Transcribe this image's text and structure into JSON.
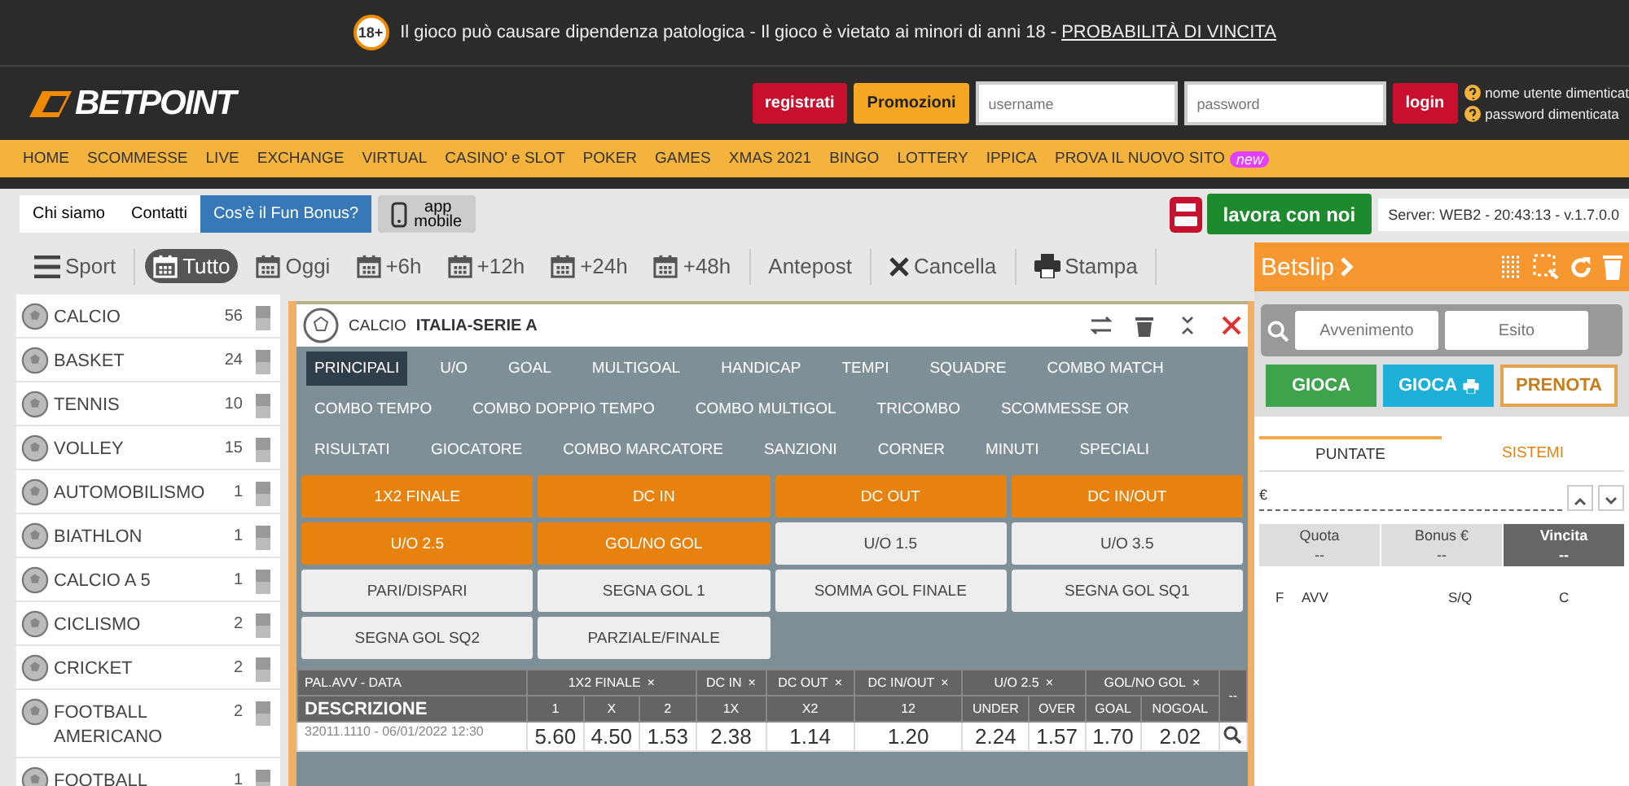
{
  "notice": {
    "badge": "18+",
    "text": "Il gioco può causare dipendenza patologica - Il gioco è vietato ai minori di anni 18 - ",
    "link": "PROBABILITÀ DI VINCITA"
  },
  "header": {
    "logo": "BETPOINT",
    "register": "registrati",
    "promo": "Promozioni",
    "username": {
      "placeholder": "username"
    },
    "password": {
      "placeholder": "password"
    },
    "login": "login",
    "help": [
      "nome utente dimenticat",
      "password dimenticata"
    ]
  },
  "nav": {
    "items": [
      "HOME",
      "SCOMMESSE",
      "LIVE",
      "EXCHANGE",
      "VIRTUAL",
      "CASINO' e SLOT",
      "POKER",
      "GAMES",
      "XMAS 2021",
      "BINGO",
      "LOTTERY",
      "IPPICA",
      "PROVA IL NUOVO SITO"
    ],
    "badge": "new"
  },
  "top_links": [
    {
      "label": "Chi siamo",
      "kind": "plain"
    },
    {
      "label": "Contatti",
      "kind": "plain"
    },
    {
      "label": "Cos'è il Fun Bonus?",
      "kind": "blue"
    },
    {
      "label": "app\nmobile",
      "kind": "app"
    }
  ],
  "jobs": "lavora con noi",
  "server": "Server: WEB2 - 20:43:13 - v.1.7.0.0",
  "filters": [
    {
      "label": "Sport",
      "kind": "menu",
      "selected": false
    },
    {
      "label": "Tutto",
      "kind": "date",
      "selected": true
    },
    {
      "label": "Oggi",
      "kind": "date",
      "selected": false
    },
    {
      "label": "+6h",
      "kind": "date",
      "selected": false
    },
    {
      "label": "+12h",
      "kind": "date",
      "selected": false
    },
    {
      "label": "+24h",
      "kind": "date",
      "selected": false
    },
    {
      "label": "+48h",
      "kind": "date",
      "selected": false
    },
    {
      "label": "Antepost",
      "kind": "plain",
      "selected": false
    },
    {
      "label": "Cancella",
      "kind": "clear",
      "selected": false
    },
    {
      "label": "Stampa",
      "kind": "print",
      "selected": false
    }
  ],
  "sports": [
    {
      "name": "CALCIO",
      "count": "56"
    },
    {
      "name": "BASKET",
      "count": "24"
    },
    {
      "name": "TENNIS",
      "count": "10"
    },
    {
      "name": "VOLLEY",
      "count": "15"
    },
    {
      "name": "AUTOMOBILISMO",
      "count": "1"
    },
    {
      "name": "BIATHLON",
      "count": "1"
    },
    {
      "name": "CALCIO A 5",
      "count": "1"
    },
    {
      "name": "CICLISMO",
      "count": "2"
    },
    {
      "name": "CRICKET",
      "count": "2"
    },
    {
      "name": "FOOTBALL AMERICANO",
      "count": "2"
    },
    {
      "name": "FOOTBALL",
      "count": "1"
    }
  ],
  "event": {
    "sport": "CALCIO",
    "league": "ITALIA-SERIE A",
    "market_tabs": [
      {
        "label": "PRINCIPALI",
        "selected": true
      },
      {
        "label": "U/O",
        "selected": false
      },
      {
        "label": "GOAL",
        "selected": false
      },
      {
        "label": "MULTIGOAL",
        "selected": false
      },
      {
        "label": "HANDICAP",
        "selected": false
      },
      {
        "label": "TEMPI",
        "selected": false
      },
      {
        "label": "SQUADRE",
        "selected": false
      },
      {
        "label": "COMBO MATCH",
        "selected": false
      },
      {
        "label": "COMBO TEMPO",
        "selected": false
      },
      {
        "label": "COMBO DOPPIO TEMPO",
        "selected": false
      },
      {
        "label": "COMBO MULTIGOL",
        "selected": false
      },
      {
        "label": "TRICOMBO",
        "selected": false
      },
      {
        "label": "SCOMMESSE OR",
        "selected": false
      },
      {
        "label": "RISULTATI",
        "selected": false
      },
      {
        "label": "GIOCATORE",
        "selected": false
      },
      {
        "label": "COMBO MARCATORE",
        "selected": false
      },
      {
        "label": "SANZIONI",
        "selected": false
      },
      {
        "label": "CORNER",
        "selected": false
      },
      {
        "label": "MINUTI",
        "selected": false
      },
      {
        "label": "SPECIALI",
        "selected": false
      }
    ],
    "bet_types": [
      {
        "label": "1X2 FINALE",
        "selected": true
      },
      {
        "label": "DC IN",
        "selected": true
      },
      {
        "label": "DC OUT",
        "selected": true
      },
      {
        "label": "DC IN/OUT",
        "selected": true
      },
      {
        "label": "U/O 2.5",
        "selected": true
      },
      {
        "label": "GOL/NO GOL",
        "selected": true
      },
      {
        "label": "U/O 1.5",
        "selected": false
      },
      {
        "label": "U/O 3.5",
        "selected": false
      },
      {
        "label": "PARI/DISPARI",
        "selected": false
      },
      {
        "label": "SEGNA GOL 1",
        "selected": false
      },
      {
        "label": "SOMMA GOL FINALE",
        "selected": false
      },
      {
        "label": "SEGNA GOL SQ1",
        "selected": false
      },
      {
        "label": "SEGNA GOL SQ2",
        "selected": false
      },
      {
        "label": "PARZIALE/FINALE",
        "selected": false
      }
    ],
    "table": {
      "head_top": "PAL.AVV - DATA",
      "head_main": "DESCRIZIONE",
      "close": "×",
      "extra": "--",
      "groups": [
        {
          "label": "1X2 FINALE",
          "columns": [
            "1",
            "X",
            "2"
          ]
        },
        {
          "label": "DC IN",
          "columns": [
            "1X"
          ]
        },
        {
          "label": "DC OUT",
          "columns": [
            "X2"
          ]
        },
        {
          "label": "DC IN/OUT",
          "columns": [
            "12"
          ]
        },
        {
          "label": "U/O 2.5",
          "columns": [
            "UNDER",
            "OVER"
          ]
        },
        {
          "label": "GOL/NO GOL",
          "columns": [
            "GOAL",
            "NOGOAL"
          ]
        }
      ],
      "rows": [
        {
          "info": "32011.1110 - 06/01/2022 12:30",
          "odds": [
            "5.60",
            "4.50",
            "1.53",
            "2.38",
            "1.14",
            "1.20",
            "2.24",
            "1.57",
            "1.70",
            "2.02"
          ]
        }
      ]
    }
  },
  "betslip": {
    "title": "Betslip",
    "search": [
      {
        "placeholder": "Avvenimento"
      },
      {
        "placeholder": "Esito"
      }
    ],
    "actions": [
      {
        "label": "GIOCA",
        "kind": "green"
      },
      {
        "label": "GIOCA",
        "kind": "cyan"
      },
      {
        "label": "PRENOTA",
        "kind": "outline"
      }
    ],
    "tabs": [
      {
        "label": "PUNTATE",
        "selected": true
      },
      {
        "label": "SISTEMI",
        "selected": false
      }
    ],
    "currency": "€",
    "totals": [
      {
        "label": "Quota",
        "value": "--",
        "selected": false
      },
      {
        "label": "Bonus €",
        "value": "--",
        "selected": false
      },
      {
        "label": "Vincita",
        "value": "--",
        "selected": true
      }
    ],
    "columns": [
      "F",
      "AVV",
      "S/Q",
      "C"
    ]
  }
}
